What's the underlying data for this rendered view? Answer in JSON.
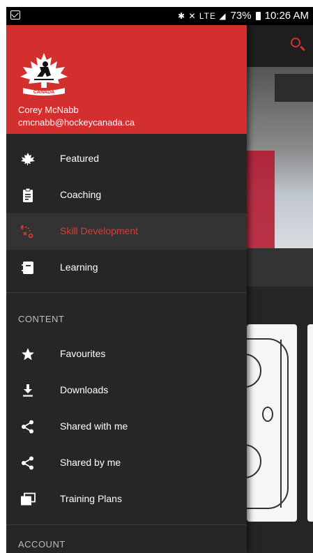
{
  "status_bar": {
    "icons": "✱ ✕ LTE ◢",
    "battery": "73%",
    "time": "10:26 AM"
  },
  "drawer": {
    "user_name": "Corey McNabb",
    "user_email": "cmcnabb@hockeycanada.ca",
    "logo_text": "CANADA",
    "main_items": [
      {
        "label": "Featured",
        "icon": "maple-leaf-icon"
      },
      {
        "label": "Coaching",
        "icon": "clipboard-icon"
      },
      {
        "label": "Skill Development",
        "icon": "drill-path-icon",
        "active": true
      },
      {
        "label": "Learning",
        "icon": "notebook-icon"
      }
    ],
    "content_header": "CONTENT",
    "content_items": [
      {
        "label": "Favourites",
        "icon": "star-icon"
      },
      {
        "label": "Downloads",
        "icon": "download-icon"
      },
      {
        "label": "Shared with me",
        "icon": "share-icon"
      },
      {
        "label": "Shared by me",
        "icon": "share-icon"
      },
      {
        "label": "Training Plans",
        "icon": "stack-icon"
      }
    ],
    "account_header": "ACCOUNT"
  },
  "colors": {
    "brand_red": "#d32f2f",
    "active_text": "#e53935",
    "drawer_bg": "#262626"
  }
}
